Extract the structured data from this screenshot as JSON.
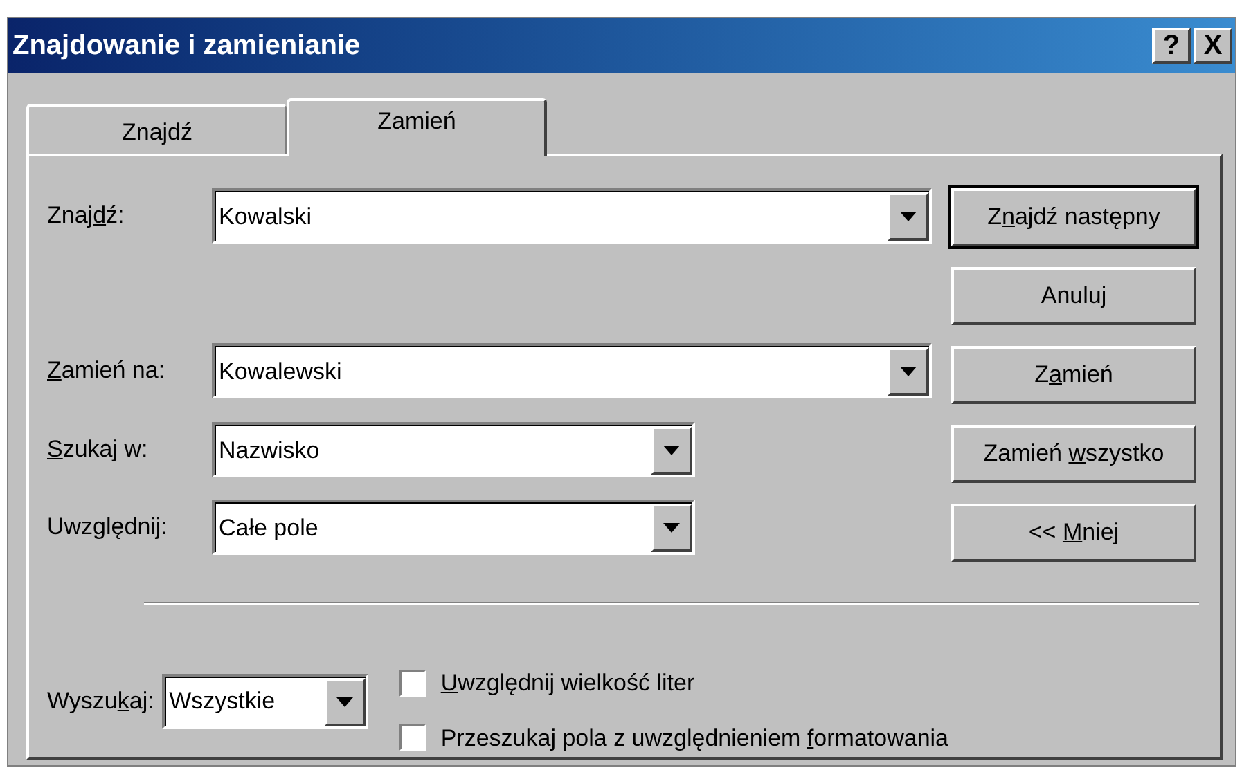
{
  "window": {
    "title": "Znajdowanie i zamienianie",
    "controls": [
      {
        "label": "?"
      },
      {
        "label": "X"
      }
    ]
  },
  "tabs": [
    {
      "label": "Znajdź",
      "selected": false
    },
    {
      "label": "Zamień",
      "selected": true
    }
  ],
  "fields": [
    {
      "label": {
        "pre": "Znaj",
        "key": "d",
        "post": "ź:"
      },
      "value": "Kowalski",
      "kind": "wide"
    },
    {
      "label": {
        "key": "Z",
        "post": "amień na:"
      },
      "value": "Kowalewski",
      "kind": "wide"
    },
    {
      "label": {
        "key": "S",
        "post": "zukaj w:"
      },
      "value": "Nazwisko",
      "kind": "medium"
    },
    {
      "label": {
        "pre": "Uwzględnij:"
      },
      "value": "Całe pole",
      "kind": "medium"
    }
  ],
  "buttons": [
    {
      "label": {
        "pre": "Z",
        "key": "n",
        "post": "ajdź następny"
      },
      "default": true
    },
    {
      "label": {
        "pre": "Anuluj"
      },
      "default": false
    },
    {
      "label": {
        "pre": "Z",
        "key": "a",
        "post": "mień"
      },
      "default": false
    },
    {
      "label": {
        "pre": "Zamień ",
        "key": "w",
        "post": "szystko"
      },
      "default": false
    },
    {
      "label": {
        "pre": "<< ",
        "key": "M",
        "post": "niej"
      },
      "default": false
    }
  ],
  "search_direction": {
    "label": {
      "pre": "Wyszu",
      "key": "k",
      "post": "aj:"
    },
    "value": "Wszystkie"
  },
  "options": [
    {
      "label": {
        "key": "U",
        "post": "względnij wielkość liter"
      },
      "checked": false
    },
    {
      "label": {
        "pre": "Przeszukaj pola z uwzględnieniem ",
        "key": "f",
        "post": "ormatowania"
      },
      "checked": false
    }
  ]
}
